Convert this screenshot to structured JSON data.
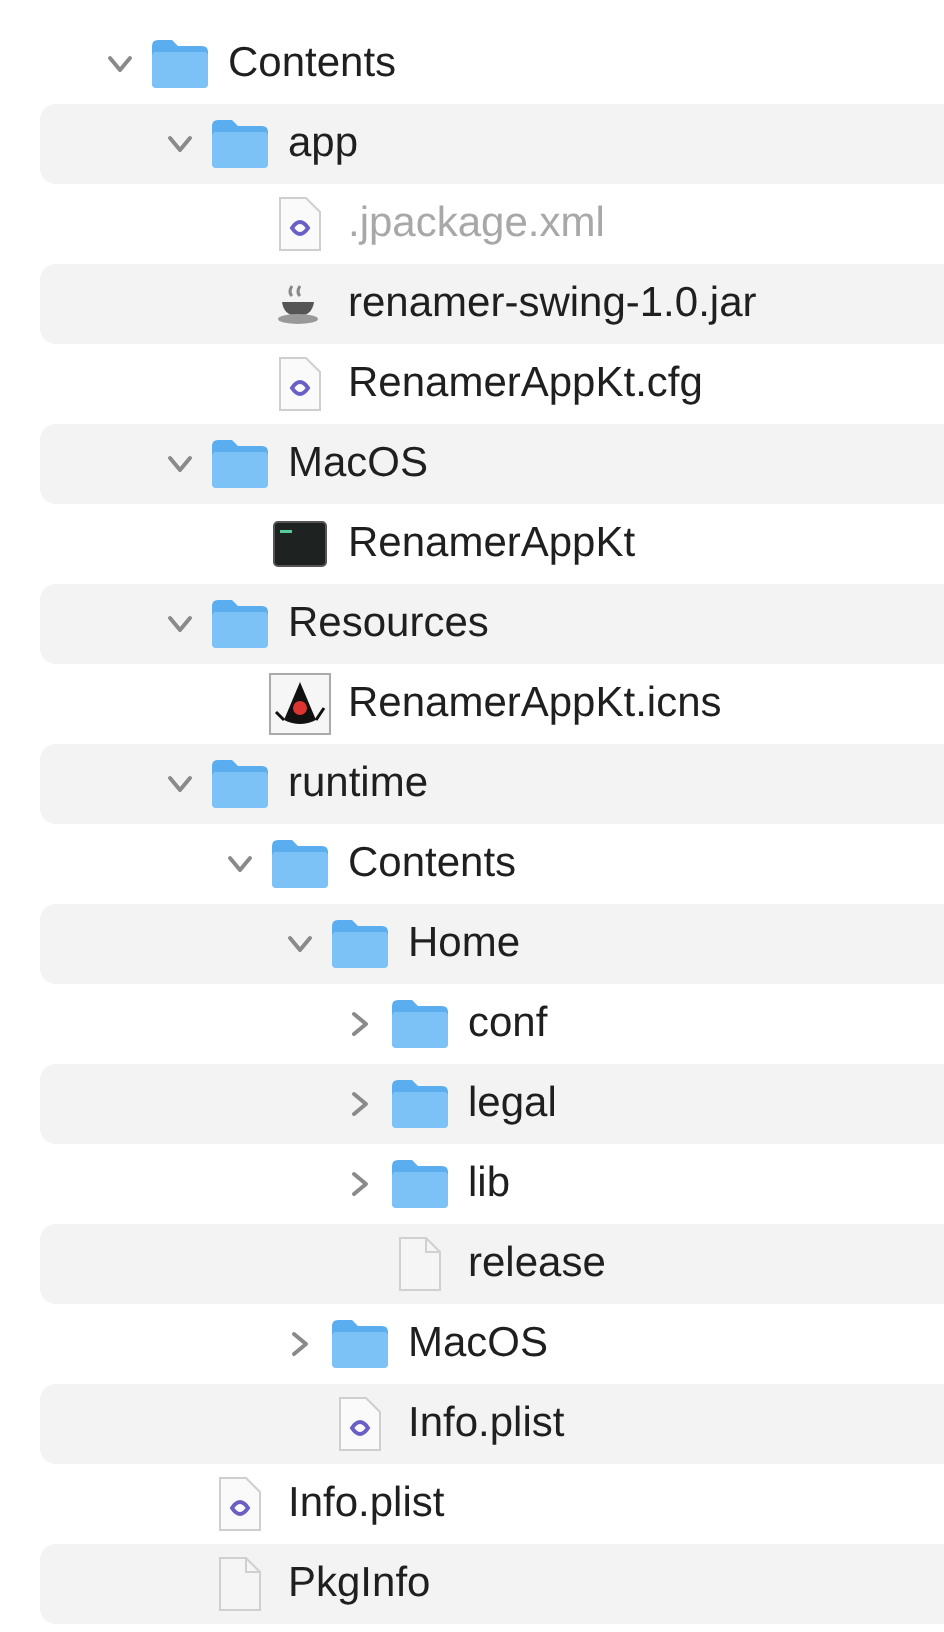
{
  "tree": [
    {
      "name": "Contents",
      "kind": "folder",
      "expanded": true,
      "children": [
        {
          "name": "app",
          "kind": "folder",
          "expanded": true,
          "children": [
            {
              "name": ".jpackage.xml",
              "kind": "plist",
              "hidden": true
            },
            {
              "name": "renamer-swing-1.0.jar",
              "kind": "jar",
              "hidden": false
            },
            {
              "name": "RenamerAppKt.cfg",
              "kind": "plist",
              "hidden": false
            }
          ]
        },
        {
          "name": "MacOS",
          "kind": "folder",
          "expanded": true,
          "children": [
            {
              "name": "RenamerAppKt",
              "kind": "exec",
              "hidden": false
            }
          ]
        },
        {
          "name": "Resources",
          "kind": "folder",
          "expanded": true,
          "children": [
            {
              "name": "RenamerAppKt.icns",
              "kind": "icns",
              "hidden": false
            }
          ]
        },
        {
          "name": "runtime",
          "kind": "folder",
          "expanded": true,
          "children": [
            {
              "name": "Contents",
              "kind": "folder",
              "expanded": true,
              "children": [
                {
                  "name": "Home",
                  "kind": "folder",
                  "expanded": true,
                  "children": [
                    {
                      "name": "conf",
                      "kind": "folder",
                      "expanded": false
                    },
                    {
                      "name": "legal",
                      "kind": "folder",
                      "expanded": false
                    },
                    {
                      "name": "lib",
                      "kind": "folder",
                      "expanded": false
                    },
                    {
                      "name": "release",
                      "kind": "blank",
                      "hidden": false
                    }
                  ]
                },
                {
                  "name": "MacOS",
                  "kind": "folder",
                  "expanded": false
                },
                {
                  "name": "Info.plist",
                  "kind": "plist",
                  "hidden": false
                }
              ]
            }
          ]
        },
        {
          "name": "Info.plist",
          "kind": "plist",
          "hidden": false
        },
        {
          "name": "PkgInfo",
          "kind": "blank",
          "hidden": false
        }
      ]
    }
  ]
}
